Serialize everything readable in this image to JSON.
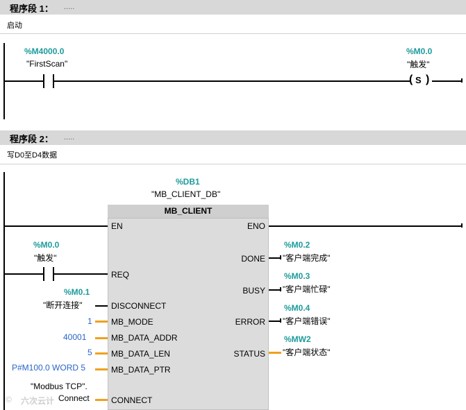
{
  "network1": {
    "title": "程序段 1：",
    "dots": ".....",
    "comment": "启动",
    "contact": {
      "address": "%M4000.0",
      "name": "\"FirstScan\""
    },
    "coil": {
      "address": "%M0.0",
      "name": "\"触发\"",
      "symbol": "S"
    }
  },
  "network2": {
    "title": "程序段 2：",
    "dots": ".....",
    "comment": "写D0至D4数据",
    "block": {
      "db_address": "%DB1",
      "db_name": "\"MB_CLIENT_DB\"",
      "title": "MB_CLIENT",
      "inputs": {
        "en": "EN",
        "req": "REQ",
        "disconnect": "DISCONNECT",
        "mb_mode": "MB_MODE",
        "mb_data_addr": "MB_DATA_ADDR",
        "mb_data_len": "MB_DATA_LEN",
        "mb_data_ptr": "MB_DATA_PTR",
        "connect": "CONNECT"
      },
      "outputs": {
        "eno": "ENO",
        "done": "DONE",
        "busy": "BUSY",
        "error": "ERROR",
        "status": "STATUS"
      }
    },
    "req_contact": {
      "address": "%M0.0",
      "name": "\"触发\""
    },
    "disconnect_param": {
      "address": "%M0.1",
      "name": "\"断开连接\""
    },
    "mb_mode_value": "1",
    "mb_data_addr_value": "40001",
    "mb_data_len_value": "5",
    "mb_data_ptr_value": "P#M100.0 WORD 5",
    "connect_value_line1": "\"Modbus TCP\".",
    "connect_value_line2": "Connect",
    "done_out": {
      "address": "%M0.2",
      "name": "\"客户端完成\""
    },
    "busy_out": {
      "address": "%M0.3",
      "name": "\"客户端忙碌\""
    },
    "error_out": {
      "address": "%M0.4",
      "name": "\"客户端错误\""
    },
    "status_out": {
      "address": "%MW2",
      "name": "\"客户端状态\""
    }
  },
  "watermark": "六次云计"
}
